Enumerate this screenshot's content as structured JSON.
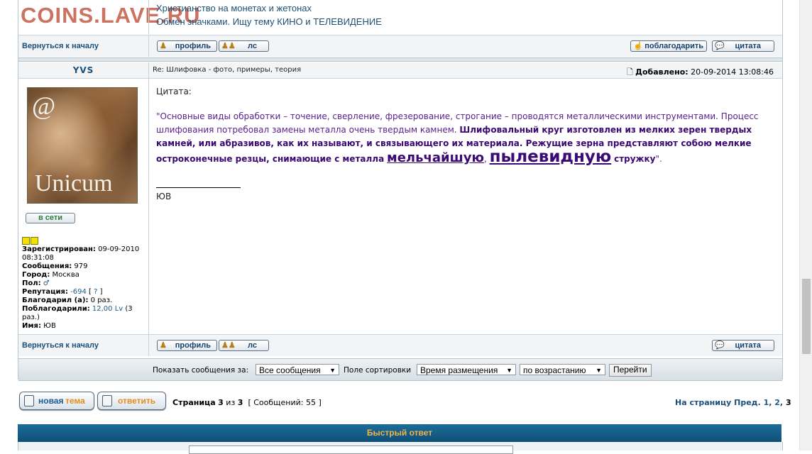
{
  "watermark": "COINS.LAVE.RU",
  "prev_post": {
    "line1": "Христианство на монетах и жетонах",
    "line2": "Обмен значками. Ищу тему КИНО и ТЕЛЕВИДЕНИЕ",
    "back_to_top": "Вернуться к началу",
    "btn_profile": "профиль",
    "btn_pm": "лс",
    "btn_thank": "поблагодарить",
    "btn_quote": "цитата"
  },
  "post": {
    "author": "YVS",
    "subject": "Re: Шлифовка - фото, примеры, теория",
    "added_label": "Добавлено:",
    "added_date": "20-09-2014 13:08:46",
    "avatar_at": "@",
    "avatar_text": "Unicum",
    "online": "в сети",
    "info": {
      "registered_label": "Зарегистрирован:",
      "registered": "09-09-2010 08:31:08",
      "messages_label": "Сообщения:",
      "messages": "979",
      "city_label": "Город:",
      "city": "Москва",
      "gender_label": "Пол:",
      "gender_icon": "♂",
      "reputation_label": "Репутация:",
      "reputation": "-694",
      "reputation_help_open": "[",
      "reputation_help": "?",
      "reputation_help_close": "]",
      "thanked_label": "Благодарил (а):",
      "thanked": "0 раз.",
      "thanked_by_label": "Поблагодарили:",
      "thanked_by_link": "12,00 Lv",
      "thanked_by_count": "(3 раз.)",
      "name_label": "Имя:",
      "name": "ЮВ"
    },
    "quote_label": "Цитата:",
    "quote_part1": "\"Основные виды обработки – точение, сверление, фрезерование, строгание – проводятся металлическими инструментами. Процесс шлифования потребовал замены металла очень твердым камнем.",
    "quote_bold": "Шлифовальный круг изготовлен из мелких зерен твердых камней, или абразивов, как их называют, и связывающего их материала. Режущие зерна представляют собою мелкие остроконечные резцы, снимающие с металла",
    "quote_big1": "мельчайшую",
    "quote_comma": ",",
    "quote_big2": "пылевидную",
    "quote_end": "стружку",
    "quote_close": "\".",
    "signature": "ЮВ",
    "back_to_top": "Вернуться к началу",
    "btn_profile": "профиль",
    "btn_pm": "лс",
    "btn_quote": "цитата"
  },
  "sort": {
    "show_label": "Показать сообщения за:",
    "show_value": "Все сообщения",
    "sort_label": "Поле сортировки",
    "sort_value": "Время размещения",
    "order_value": "по возрастанию",
    "go": "Перейти"
  },
  "bottom": {
    "new_topic_word1": "новая",
    "new_topic_word2": "тема",
    "reply": "ответить",
    "page_word": "Страница",
    "page_num": "3",
    "of_word": "из",
    "page_total": "3",
    "messages_label": "[ Сообщений: 55 ]",
    "goto_label": "На страницу",
    "prev": "Пред.",
    "page1": "1",
    "page2": "2",
    "page3": "3"
  },
  "quick_reply": "Быстрый ответ"
}
